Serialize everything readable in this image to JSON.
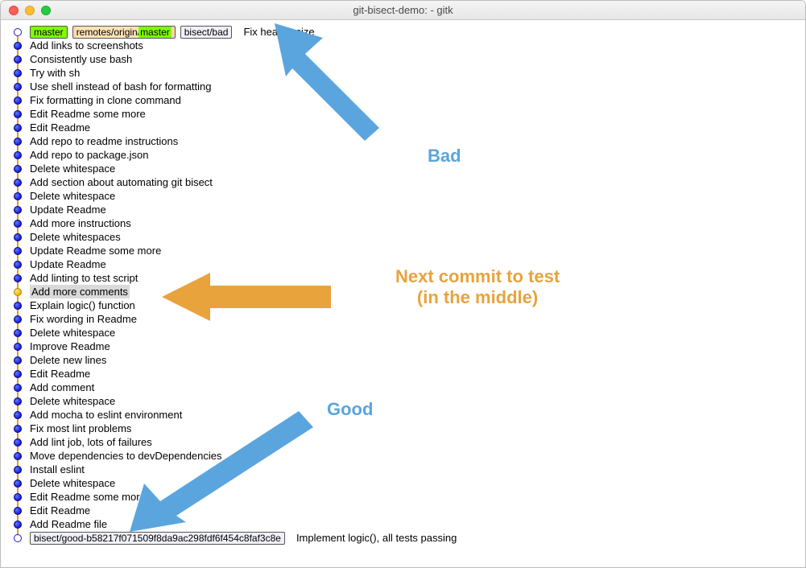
{
  "window": {
    "title": "git-bisect-demo:  - gitk"
  },
  "tags": {
    "head": "master",
    "remote_full": "remotes/origin/master",
    "bisect_bad": "bisect/bad",
    "bisect_good": "bisect/good-b58217f071509f8da9ac298fdf6f454c8faf3c8e"
  },
  "commits": [
    {
      "msg": "Fix header size",
      "head": true,
      "remote": true,
      "bad": true,
      "first": true
    },
    {
      "msg": "Add links to screenshots"
    },
    {
      "msg": "Consistently use bash"
    },
    {
      "msg": "Try with sh"
    },
    {
      "msg": "Use shell instead of bash for formatting"
    },
    {
      "msg": "Fix formatting in clone command"
    },
    {
      "msg": "Edit Readme some more"
    },
    {
      "msg": "Edit Readme"
    },
    {
      "msg": "Add repo to readme instructions"
    },
    {
      "msg": "Add repo to package.json"
    },
    {
      "msg": "Delete whitespace"
    },
    {
      "msg": "Add section about automating git bisect"
    },
    {
      "msg": "Delete whitespace"
    },
    {
      "msg": "Update Readme"
    },
    {
      "msg": "Add more instructions"
    },
    {
      "msg": "Delete whitespaces"
    },
    {
      "msg": "Update Readme some more"
    },
    {
      "msg": "Update Readme"
    },
    {
      "msg": "Add linting to test script"
    },
    {
      "msg": "Add more comments",
      "selected": true
    },
    {
      "msg": "Explain logic() function"
    },
    {
      "msg": "Fix wording in Readme"
    },
    {
      "msg": "Delete whitespace"
    },
    {
      "msg": "Improve Readme"
    },
    {
      "msg": "Delete new lines"
    },
    {
      "msg": "Edit Readme"
    },
    {
      "msg": "Add comment"
    },
    {
      "msg": "Delete whitespace"
    },
    {
      "msg": "Add mocha to eslint environment"
    },
    {
      "msg": "Fix most lint problems"
    },
    {
      "msg": "Add lint job, lots of failures"
    },
    {
      "msg": "Move dependencies to devDependencies"
    },
    {
      "msg": "Install eslint"
    },
    {
      "msg": "Delete whitespace"
    },
    {
      "msg": "Edit Readme some more"
    },
    {
      "msg": "Edit Readme"
    },
    {
      "msg": "Add Readme file"
    },
    {
      "msg": "Implement logic(), all tests passing",
      "good": true,
      "last": true
    }
  ],
  "annotations": {
    "bad": "Bad",
    "next": "Next commit to test\n(in the middle)",
    "good": "Good"
  }
}
